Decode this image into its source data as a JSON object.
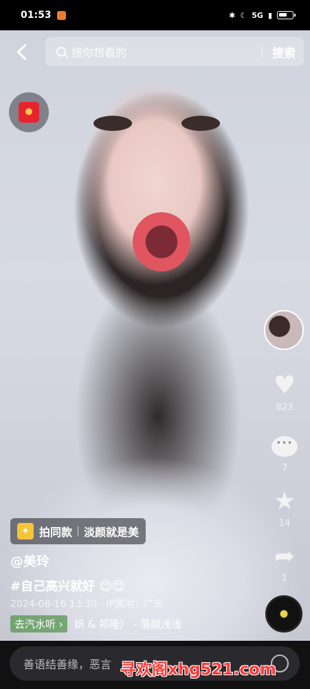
{
  "status": {
    "time": "01:53",
    "network": "5G"
  },
  "search": {
    "placeholder": "搜你想看的",
    "button": "搜索"
  },
  "rail": {
    "likes": "823",
    "comments": "7",
    "favorites": "14",
    "shares": "1"
  },
  "tag": {
    "label": "拍同款",
    "title": "淡颜就是美"
  },
  "post": {
    "author": "@美玲",
    "caption": "#自己高兴就好 😊😊",
    "meta": "2024-08-16 13:30 · IP属地：广东"
  },
  "music": {
    "pill": "去汽水听 ›",
    "track": "妍 & 祁隆） - 落颜浅浅"
  },
  "comment": {
    "placeholder": "善语结善缘，恶言"
  },
  "watermark": "寻欢阁xhg521.com"
}
